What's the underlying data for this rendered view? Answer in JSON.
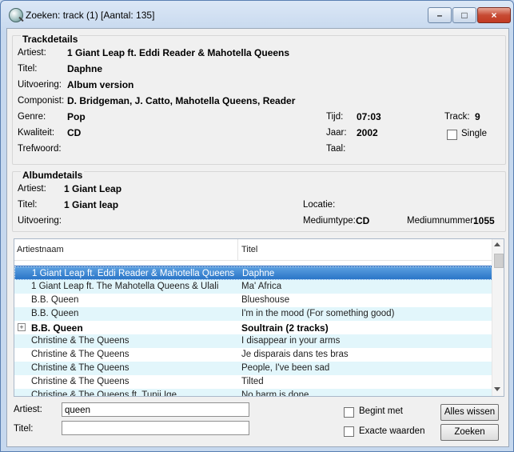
{
  "window": {
    "title": "Zoeken: track (1) [Aantal: 135]"
  },
  "track": {
    "section": "Trackdetails",
    "artist_label": "Artiest:",
    "artist": "1 Giant Leap ft. Eddi Reader & Mahotella Queens",
    "title_label": "Titel:",
    "title": "Daphne",
    "version_label": "Uitvoering:",
    "version": "Album version",
    "composer_label": "Componist:",
    "composer": "D. Bridgeman, J. Catto, Mahotella Queens, Reader",
    "genre_label": "Genre:",
    "genre": "Pop",
    "quality_label": "Kwaliteit:",
    "quality": "CD",
    "keyword_label": "Trefwoord:",
    "time_label": "Tijd:",
    "time": "07:03",
    "year_label": "Jaar:",
    "year": "2002",
    "language_label": "Taal:",
    "track_label": "Track:",
    "track_no": "9",
    "single_label": "Single"
  },
  "album": {
    "section": "Albumdetails",
    "artist_label": "Artiest:",
    "artist": "1 Giant Leap",
    "title_label": "Titel:",
    "title": "1 Giant leap",
    "version_label": "Uitvoering:",
    "location_label": "Locatie:",
    "mediumtype_label": "Mediumtype:",
    "mediumtype": "CD",
    "mediumnr_label": "Mediumnummer:",
    "mediumnr": "1055"
  },
  "list": {
    "col_artist": "Artiestnaam",
    "col_title": "Titel",
    "rows": [
      {
        "artist": "1 Giant Leap ft. Eddi Reader & Mahotella Queens",
        "title": "Daphne"
      },
      {
        "artist": "1 Giant Leap ft. The Mahotella Queens & Ulali",
        "title": "Ma' Africa"
      },
      {
        "artist": "B.B. Queen",
        "title": "Blueshouse"
      },
      {
        "artist": "B.B. Queen",
        "title": "I'm in the mood (For something good)"
      },
      {
        "artist": "B.B. Queen",
        "title": "Soultrain (2 tracks)"
      },
      {
        "artist": "Christine & The Queens",
        "title": "I disappear in your arms"
      },
      {
        "artist": "Christine & The Queens",
        "title": "Je disparais dans tes bras"
      },
      {
        "artist": "Christine & The Queens",
        "title": "People, I've been sad"
      },
      {
        "artist": "Christine & The Queens",
        "title": "Tilted"
      },
      {
        "artist": "Christine & The Queens ft. Tunji Ige",
        "title": "No harm is done"
      }
    ],
    "expander": "+"
  },
  "search": {
    "artist_label": "Artiest:",
    "artist_value": "queen",
    "title_label": "Titel:",
    "title_value": "",
    "begint_met": "Begint met",
    "exacte_waarden": "Exacte waarden",
    "clear_button": "Alles wissen",
    "search_button": "Zoeken"
  },
  "controls": {
    "minimize": "–",
    "maximize": "□",
    "close": "×"
  }
}
